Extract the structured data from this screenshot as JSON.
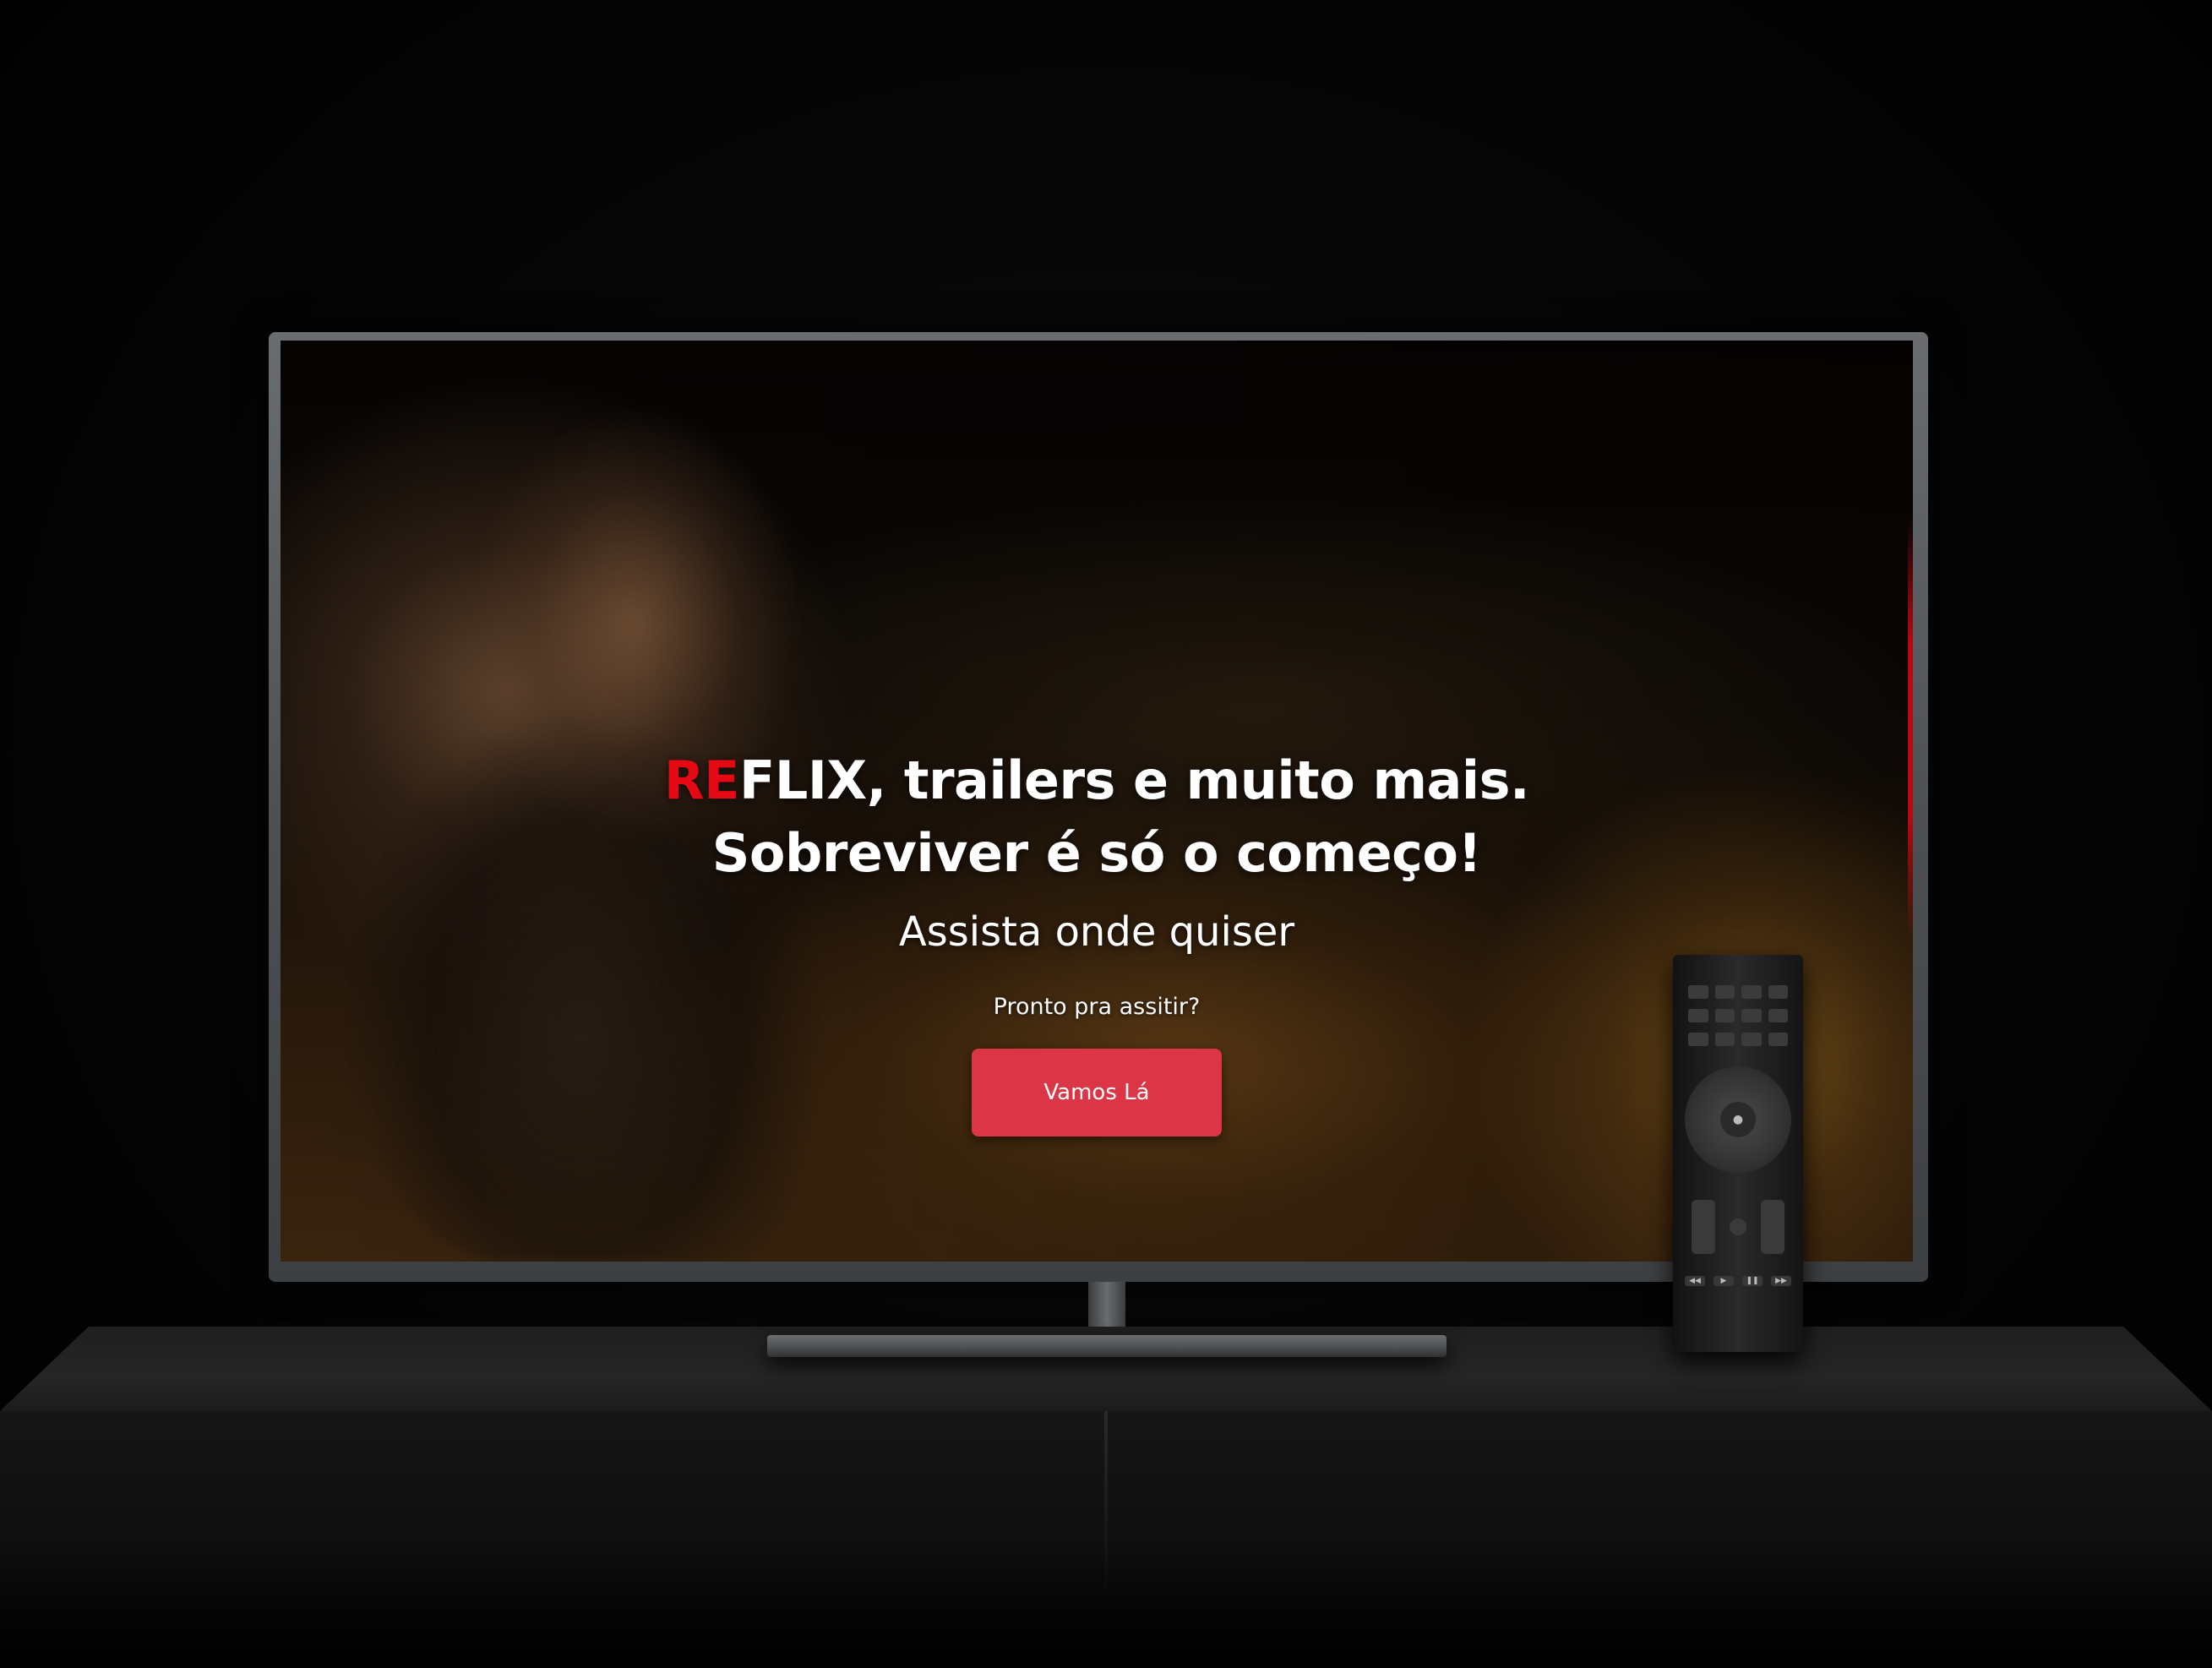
{
  "hero": {
    "brand_highlight": "RE",
    "title_line1_rest": "FLIX, trailers e muito mais.",
    "title_line2": "Sobreviver é só o começo!",
    "subtitle": "Assista onde quiser",
    "prompt": "Pronto pra assitir?",
    "cta_label": "Vamos Lá"
  },
  "colors": {
    "brand_red": "#e50914",
    "cta_background": "#dc3545",
    "text": "#ffffff",
    "background": "#000000"
  },
  "icons": {
    "remote": "tv-remote-icon"
  }
}
